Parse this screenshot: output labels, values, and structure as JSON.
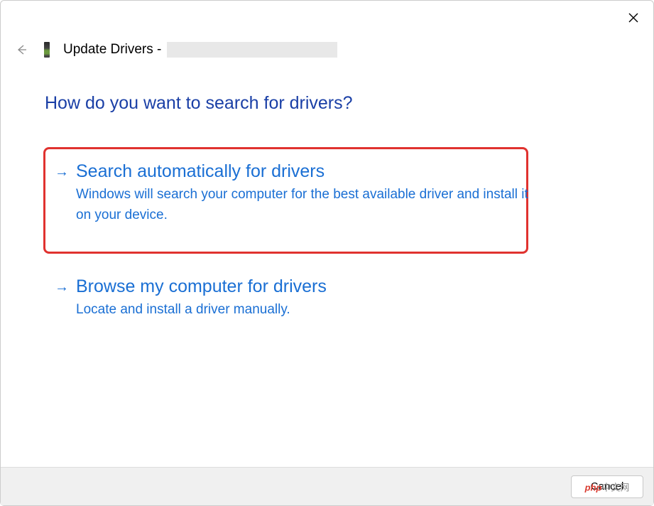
{
  "window": {
    "title_prefix": "Update Drivers - "
  },
  "heading": "How do you want to search for drivers?",
  "options": [
    {
      "title": "Search automatically for drivers",
      "description": "Windows will search your computer for the best available driver and install it on your device."
    },
    {
      "title": "Browse my computer for drivers",
      "description": "Locate and install a driver manually."
    }
  ],
  "footer": {
    "cancel_label": "Cancel"
  },
  "watermark": {
    "brand": "php",
    "suffix": "中文网"
  },
  "colors": {
    "heading_blue": "#1a3fa6",
    "link_blue": "#1a6fd4",
    "highlight_red": "#e0322f"
  }
}
